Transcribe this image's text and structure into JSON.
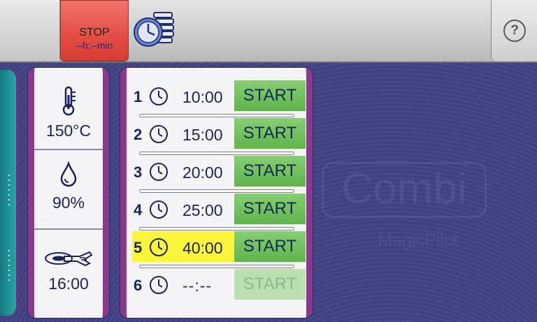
{
  "toolbar": {
    "stop": {
      "label": "STOP",
      "time": "--h:--min"
    },
    "program_icon": "clock-stack-icon",
    "help": {
      "label": "?"
    }
  },
  "watermark": {
    "title": "Combi",
    "subtitle": "MagicPilot"
  },
  "params": [
    {
      "icon": "thermometer-icon",
      "value": "150°C"
    },
    {
      "icon": "humidity-drop-icon",
      "value": "90%"
    },
    {
      "icon": "core-probe-icon",
      "value": "16:00"
    }
  ],
  "steps": [
    {
      "number": "1",
      "time": "10:00",
      "start": "START",
      "active": false,
      "enabled": true
    },
    {
      "number": "2",
      "time": "15:00",
      "start": "START",
      "active": false,
      "enabled": true
    },
    {
      "number": "3",
      "time": "20:00",
      "start": "START",
      "active": false,
      "enabled": true
    },
    {
      "number": "4",
      "time": "25:00",
      "start": "START",
      "active": false,
      "enabled": true
    },
    {
      "number": "5",
      "time": "40:00",
      "start": "START",
      "active": true,
      "enabled": true
    },
    {
      "number": "6",
      "time": "--:--",
      "start": "START",
      "active": false,
      "enabled": false
    }
  ],
  "colors": {
    "background": "#3f4181",
    "accent_frame": "#8a3a8e",
    "start_green": "#5fb34e",
    "active_highlight": "#fbf53c",
    "stop_red": "#e44d44",
    "text_navy": "#1d2356"
  }
}
